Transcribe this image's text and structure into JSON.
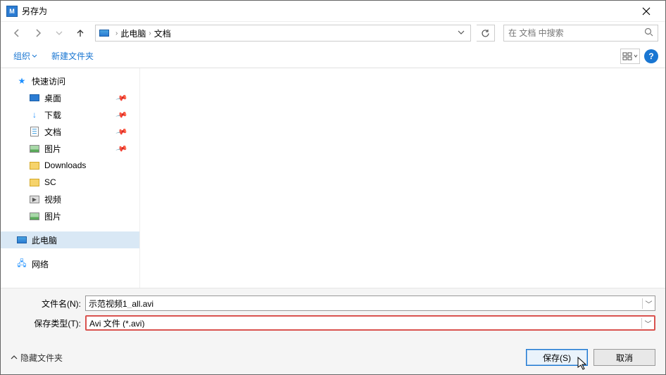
{
  "title": "另存为",
  "breadcrumb": {
    "root": "此电脑",
    "folder": "文档"
  },
  "search": {
    "placeholder": "在 文档 中搜索"
  },
  "toolbar": {
    "organize": "组织",
    "newfolder": "新建文件夹"
  },
  "sidebar": {
    "quick": "快速访问",
    "desktop": "桌面",
    "downloads_cn": "下载",
    "documents_cn": "文档",
    "pictures_cn": "图片",
    "downloads_en": "Downloads",
    "sc": "SC",
    "video": "视频",
    "pictures2": "图片",
    "thispc": "此电脑",
    "network": "网络"
  },
  "form": {
    "filename_label": "文件名(N):",
    "filename_value": "示范视频1_all.avi",
    "filetype_label": "保存类型(T):",
    "filetype_value": "Avi 文件 (*.avi)"
  },
  "footer": {
    "hidefolders": "隐藏文件夹",
    "save": "保存(S)",
    "cancel": "取消"
  }
}
